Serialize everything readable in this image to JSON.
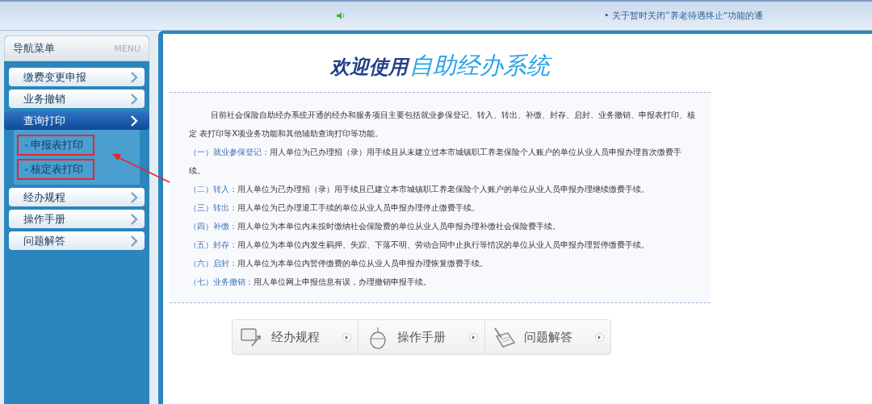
{
  "top_bar": {
    "notice": "• 关于暂时关闭“养老待遇终止”功能的通"
  },
  "sidebar": {
    "title": "导航菜单",
    "title_en": "MENU",
    "items": [
      {
        "label": "缴费变更申报",
        "selected": false
      },
      {
        "label": "业务撤销",
        "selected": false
      },
      {
        "label": "查询打印",
        "selected": true,
        "children": [
          {
            "label": "申报表打印",
            "highlighted": true
          },
          {
            "label": "核定表打印",
            "highlighted": true
          }
        ]
      },
      {
        "label": "经办规程",
        "selected": false
      },
      {
        "label": "操作手册",
        "selected": false
      },
      {
        "label": "问题解答",
        "selected": false
      }
    ]
  },
  "welcome": {
    "title_lead": "欢迎使用",
    "title_main": "自助经办系统"
  },
  "intro": "目前社会保险自助经办系统开通的经办和服务项目主要包括就业参保登记、转入、转出、补缴、封存、启封、业务撤销、申报表打印、核定 表打印等X项业务功能和其他辅助查询打印等功能。",
  "services": [
    {
      "label": "（一）就业参保登记：",
      "text": "用人单位为已办理招（录）用手续且从未建立过本市城镇职工养老保险个人账户的单位从业人员申报办理首次缴费手续。"
    },
    {
      "label": "（二）转入：",
      "text": "用人单位为已办理招（录）用手续且已建立本市城镇职工养老保险个人账户的单位从业人员申报办理继续缴费手续。"
    },
    {
      "label": "（三）转出：",
      "text": "用人单位为已办理退工手续的单位从业人员申报办理停止缴费手续。"
    },
    {
      "label": "（四）补缴：",
      "text": "用人单位为本单位内未按时缴纳社会保险费的单位从业人员申报办理补缴社会保险费手续。"
    },
    {
      "label": "（五）封存：",
      "text": "用人单位为本单位内发生羁押、失踪、下落不明、劳动合同中止执行等情况的单位从业人员申报办理暂停缴费手续。"
    },
    {
      "label": "（六）启封：",
      "text": "用人单位为本单位内暂停缴费的单位从业人员申报办理恢复缴费手续。"
    },
    {
      "label": "（七）业务撤销：",
      "text": "用人单位网上申报信息有误，办理撤销申报手续。"
    }
  ],
  "quick_links": [
    {
      "kind": "monitor",
      "label": "经办规程"
    },
    {
      "kind": "mouse",
      "label": "操作手册"
    },
    {
      "kind": "notebook",
      "label": "问题解答"
    }
  ]
}
